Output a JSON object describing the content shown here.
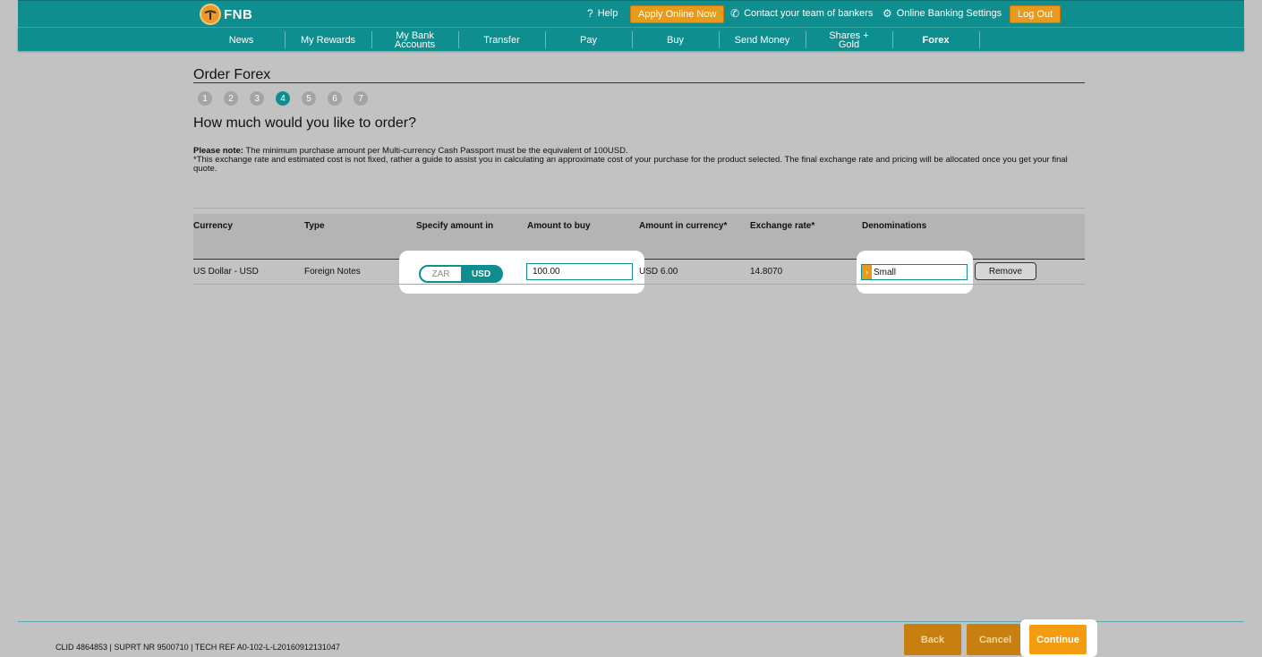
{
  "header": {
    "logo_text": "FNB",
    "help_label": "Help",
    "apply_label": "Apply Online Now",
    "contact_label": "Contact your team of bankers",
    "settings_label": "Online Banking Settings",
    "logout_label": "Log Out"
  },
  "nav": {
    "items": [
      {
        "label": "News"
      },
      {
        "label": "My Rewards"
      },
      {
        "label": "My Bank\nAccounts"
      },
      {
        "label": "Transfer"
      },
      {
        "label": "Pay"
      },
      {
        "label": "Buy"
      },
      {
        "label": "Send Money"
      },
      {
        "label": "Shares +\nGold"
      },
      {
        "label": "Forex"
      }
    ]
  },
  "page": {
    "title": "Order Forex",
    "steps": [
      "1",
      "2",
      "3",
      "4",
      "5",
      "6",
      "7"
    ],
    "active_step": "4",
    "question": "How much would you like to order?",
    "note_bold": "Please note:",
    "note_line1": " The minimum purchase amount per Multi-currency Cash Passport must be the equivalent of 100USD.",
    "note_line2": "*This exchange rate and estimated cost is not fixed, rather a guide to assist you in calculating an approximate cost of your purchase for the product selected. The final exchange rate and pricing will be allocated once you get your final quote."
  },
  "table": {
    "headers": {
      "currency": "Currency",
      "type": "Type",
      "specify": "Specify amount in",
      "amount": "Amount to buy",
      "amount_currency": "Amount in currency*",
      "rate": "Exchange rate*",
      "denominations": "Denominations"
    },
    "row": {
      "currency": "US Dollar - USD",
      "type": "Foreign Notes",
      "toggle_off": "ZAR",
      "toggle_on": "USD",
      "amount_value": "100.00",
      "amount_currency": "USD 6.00",
      "rate": "14.8070",
      "denomination": "Small",
      "remove_label": "Remove"
    }
  },
  "footer": {
    "ref_text": "CLID 4864853 | SUPRT NR 9500710 | TECH REF A0-102-L-L20160912131047",
    "back_label": "Back",
    "cancel_label": "Cancel",
    "continue_label": "Continue"
  },
  "colors": {
    "brand_teal": "#0e8e8e",
    "accent_orange": "#e89a1c",
    "overlay_gray": "#c2c2c2"
  }
}
